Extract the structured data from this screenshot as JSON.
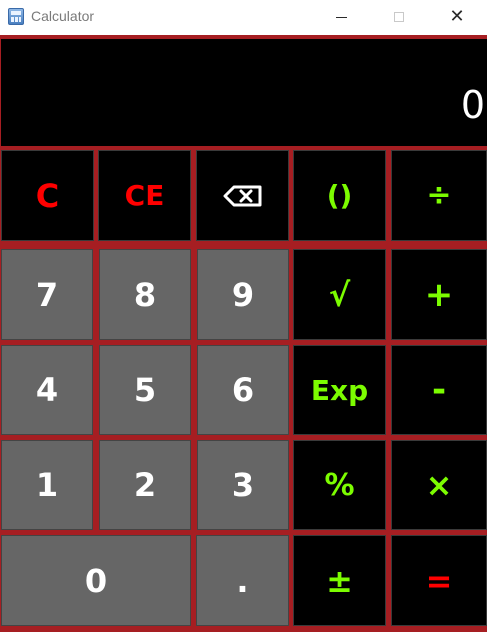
{
  "window": {
    "title": "Calculator",
    "minimize_glyph": "",
    "maximize_glyph": "",
    "close_glyph": "✕"
  },
  "display": {
    "value": "0"
  },
  "keys": {
    "clear": "C",
    "clear_entry": "CE",
    "backspace_icon": "backspace-icon",
    "parentheses": "()",
    "divide": "÷",
    "seven": "7",
    "eight": "8",
    "nine": "9",
    "sqrt": "√",
    "plus": "+",
    "four": "4",
    "five": "5",
    "six": "6",
    "exp": "Exp",
    "minus": "-",
    "one": "1",
    "two": "2",
    "three": "3",
    "percent": "%",
    "multiply": "×",
    "zero": "0",
    "decimal": ".",
    "plus_minus": "±",
    "equals": "="
  },
  "colors": {
    "frame": "#a61e22",
    "display_bg": "#000000",
    "operator_bg": "#000000",
    "digit_bg": "#666666",
    "clear_text": "#ff0000",
    "operator_text": "#7cfc00",
    "digit_text": "#ffffff",
    "equals_text": "#ff0000"
  }
}
